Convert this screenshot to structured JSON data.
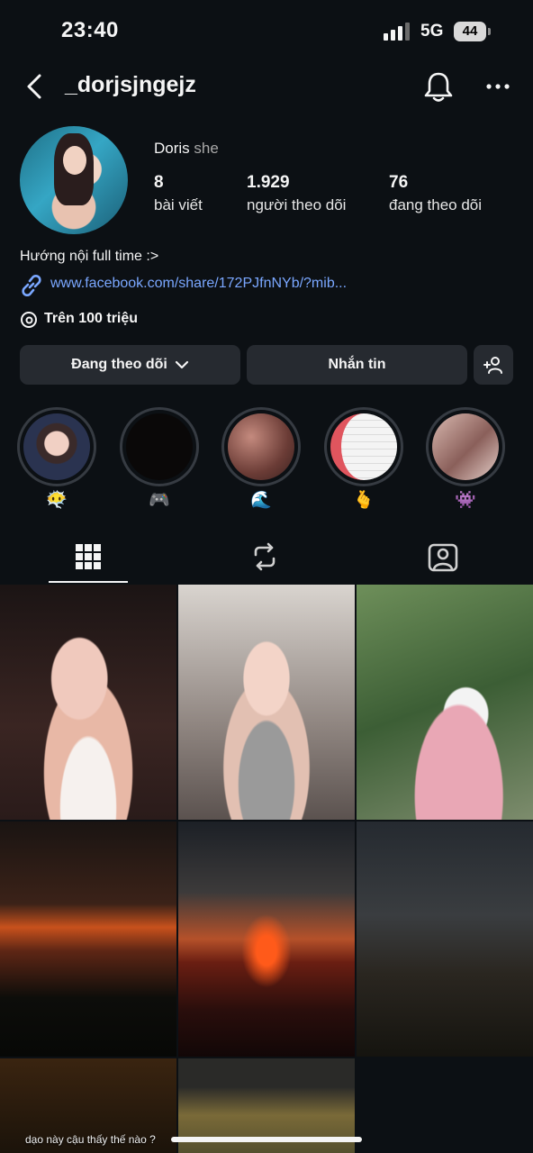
{
  "status_bar": {
    "time": "23:40",
    "network": "5G",
    "battery": "44"
  },
  "header": {
    "username": "_dorjsjngejz"
  },
  "profile": {
    "name": "Doris",
    "pronoun": "she",
    "stats": [
      {
        "value": "8",
        "label": "bài viết"
      },
      {
        "value": "1.929",
        "label": "người theo dõi"
      },
      {
        "value": "76",
        "label": "đang theo dõi"
      }
    ],
    "bio": "Hướng nội full time :>",
    "link": "www.facebook.com/share/172PJfnNYb/?mib...",
    "threads_label": "Trên 100 triệu"
  },
  "actions": {
    "following": "Đang theo dõi",
    "message": "Nhắn tin"
  },
  "highlights": [
    {
      "emoji": "😶‍🌫️"
    },
    {
      "emoji": "🎮"
    },
    {
      "emoji": "🌊"
    },
    {
      "emoji": "🫰"
    },
    {
      "emoji": "👾"
    }
  ],
  "post_caption": "dạo này cậu thấy thế nào ?",
  "colors": {
    "background": "#0c1014",
    "button": "#262a30",
    "link": "#7aa7ff"
  },
  "icons": [
    "chevron-left-icon",
    "bell-icon",
    "more-icon",
    "link-icon",
    "threads-icon",
    "add-person-icon",
    "grid-icon",
    "reels-icon",
    "tagged-icon"
  ]
}
